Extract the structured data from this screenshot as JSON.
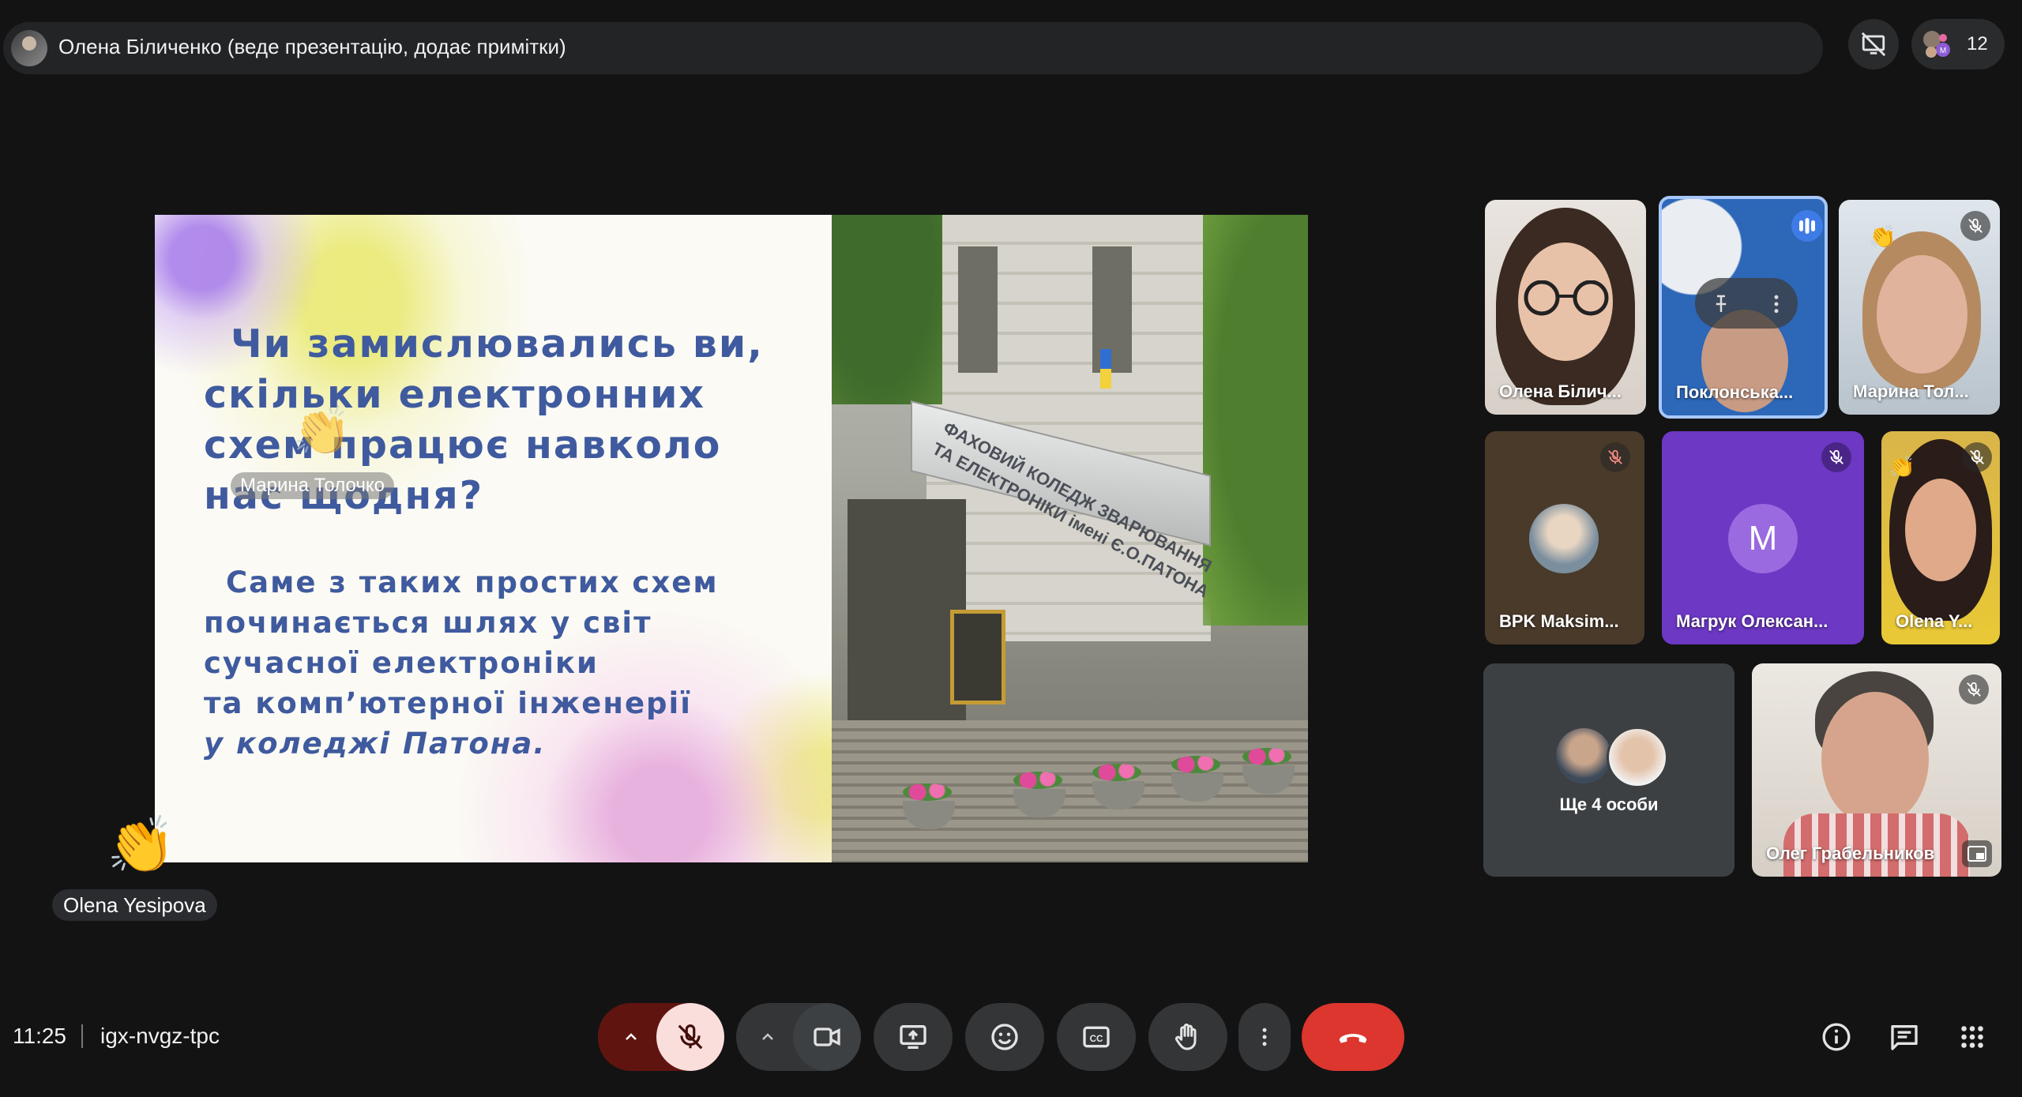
{
  "top": {
    "presenter": "Олена Біличенко (веде презентацію, додає примітки)",
    "participants_count": "12"
  },
  "slide": {
    "question_lines": [
      "Чи замислювались ви,",
      "скільки електронних",
      "схем працює навколо",
      "нас щодня?"
    ],
    "body_lines": [
      "Саме з таких простих схем",
      "починається шлях у світ",
      "сучасної електроніки",
      "та комп’ютерної інженерії"
    ],
    "emphasis": "у коледжі Патона.",
    "photo_sign": [
      "ФАХОВИЙ КОЛЕДЖ ЗВАРЮВАННЯ",
      "ТА ЕЛЕКТРОНІКИ імені Є.О.ПАТОНА"
    ]
  },
  "reactions": {
    "slide_overlay_name": "Марина Толочко",
    "floating_name": "Olena Yesipova",
    "emoji": "👏"
  },
  "tiles": [
    {
      "name": "Олена Білич..."
    },
    {
      "name": "Поклонська..."
    },
    {
      "name": "Марина Тол..."
    },
    {
      "name": "BPK Maksim..."
    },
    {
      "name": "Магрук Олексан...",
      "initial": "M"
    },
    {
      "name": "Olena Y..."
    },
    {
      "name": "Ще 4 особи"
    },
    {
      "name": "Олег Грабельников"
    }
  ],
  "bottom": {
    "time": "11:25",
    "meeting_code": "igx-nvgz-tpc"
  },
  "colors": {
    "background": "#131314",
    "end_call": "#dc362e",
    "mic_off_bg": "#f9dedc",
    "mic_chevron_bg": "#601410",
    "speaking_border": "#a8c7fa",
    "slide_text": "#3f5a9e"
  }
}
